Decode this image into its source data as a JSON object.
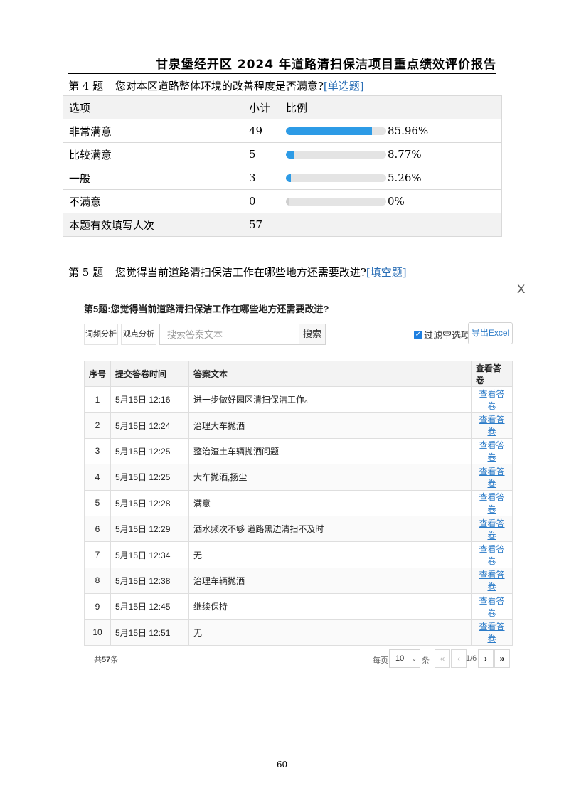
{
  "header": {
    "title": "甘泉堡经开区 2024 年道路清扫保洁项目重点绩效评价报告"
  },
  "q4": {
    "number": "第 4 题",
    "text": "您对本区道路整体环境的改善程度是否满意?",
    "type_tag": "[单选题]",
    "columns": [
      "选项",
      "小计",
      "比例"
    ],
    "rows": [
      {
        "option": "非常满意",
        "count": "49",
        "percent": "85.96%",
        "ratio": 0.8596
      },
      {
        "option": "比较满意",
        "count": "5",
        "percent": "8.77%",
        "ratio": 0.0877
      },
      {
        "option": "一般",
        "count": "3",
        "percent": "5.26%",
        "ratio": 0.0526
      },
      {
        "option": "不满意",
        "count": "0",
        "percent": "0%",
        "ratio": 0
      }
    ],
    "total_label": "本题有效填写人次",
    "total": "57"
  },
  "q5": {
    "number": "第 5 题",
    "text": "您觉得当前道路清扫保洁工作在哪些地方还需要改进?",
    "type_tag": "[填空题]",
    "widget": {
      "close": "X",
      "title": "第5题:您觉得当前道路清扫保洁工作在哪些地方还需要改进?",
      "toolbar": {
        "word_cloud": "词频分析",
        "viewpoint": "观点分析",
        "search_placeholder": "搜索答案文本",
        "search_button": "搜索",
        "filter_label": "过滤空选项",
        "export_button": "导出Excel"
      },
      "columns": [
        "序号",
        "提交答卷时间",
        "答案文本",
        "查看答卷"
      ],
      "rows": [
        {
          "id": "1",
          "time": "5月15日 12:16",
          "answer": "进一步做好园区清扫保洁工作。",
          "link": "查看答卷"
        },
        {
          "id": "2",
          "time": "5月15日 12:24",
          "answer": "治理大车抛洒",
          "link": "查看答卷"
        },
        {
          "id": "3",
          "time": "5月15日 12:25",
          "answer": "整治渣土车辆抛洒问题",
          "link": "查看答卷"
        },
        {
          "id": "4",
          "time": "5月15日 12:25",
          "answer": "大车抛洒,扬尘",
          "link": "查看答卷"
        },
        {
          "id": "5",
          "time": "5月15日 12:28",
          "answer": "满意",
          "link": "查看答卷"
        },
        {
          "id": "6",
          "time": "5月15日 12:29",
          "answer": "洒水频次不够 道路黑边清扫不及时",
          "link": "查看答卷"
        },
        {
          "id": "7",
          "time": "5月15日 12:34",
          "answer": "无",
          "link": "查看答卷"
        },
        {
          "id": "8",
          "time": "5月15日 12:38",
          "answer": "治理车辆抛洒",
          "link": "查看答卷"
        },
        {
          "id": "9",
          "time": "5月15日 12:45",
          "answer": "继续保持",
          "link": "查看答卷"
        },
        {
          "id": "10",
          "time": "5月15日 12:51",
          "answer": "无",
          "link": "查看答卷"
        }
      ],
      "footer": {
        "total_prefix": "共",
        "total": "57",
        "total_suffix": "条",
        "per_page_label": "每页",
        "per_page": "10",
        "per_page_unit": "条",
        "first": "«",
        "prev": "‹",
        "page_indicator": "1/6",
        "next": "›",
        "last": "»"
      }
    }
  },
  "page_number": "60"
}
